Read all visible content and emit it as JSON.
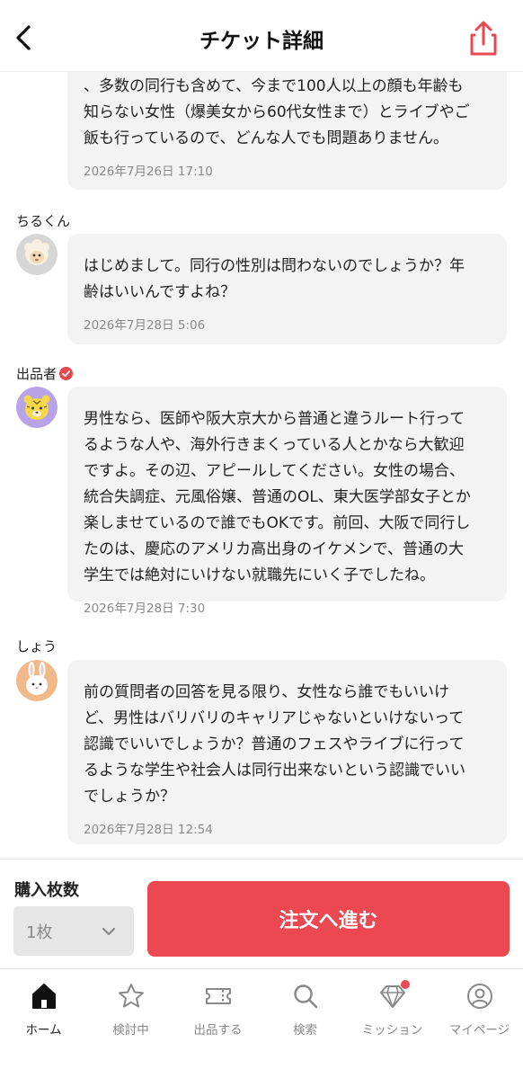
{
  "header": {
    "title": "チケット詳細"
  },
  "messages": [
    {
      "sender": "",
      "text": "、多数の同行も含めて、今まで100人以上の顔も年齢も\n知らない女性（爆美女から60代女性まで）とライブやご\n飯も行っているので、どんな人でも問題ありません。",
      "time": "2026年7月26日 17:10"
    },
    {
      "sender": "ちるくん",
      "avatar_icon": "sheep-avatar-icon",
      "text": "はじめまして。同行の性別は問わないのでしょうか？年\n齢はいいんですよね？",
      "time": "2026年7月28日 5:06"
    },
    {
      "sender": "出品者",
      "verified": true,
      "avatar_icon": "tiger-avatar-icon",
      "text": "男性なら、医師や阪大京大から普通と違うルート行って\nるような人や、海外行きまくっている人とかなら大歓迎\nですよ。その辺、アピールしてください。女性の場合、\n統合失調症、元風俗嬢、普通のOL、東大医学部女子とか\n楽しませているので誰でもOKです。前回、大阪で同行し\nたのは、慶応のアメリカ高出身のイケメンで、普通の大\n学生では絶対にいけない就職先にいく子でしたね。",
      "time": "2026年7月28日 7:30"
    },
    {
      "sender": "しょう",
      "avatar_icon": "rabbit-avatar-icon",
      "text": "前の質問者の回答を見る限り、女性なら誰でもいいけ\nど、男性はバリバリのキャリアじゃないといけないって\n認識でいいでしょうか？普通のフェスやライブに行って\nるような学生や社会人は同行出来ないという認識でいい\nでしょうか？",
      "time": "2026年7月28日 12:54"
    }
  ],
  "purchase": {
    "qty_label": "購入枚数",
    "qty_value": "1枚",
    "order_button": "注文へ進む"
  },
  "nav": {
    "items": [
      {
        "label": "ホーム",
        "icon": "home-icon",
        "active": true
      },
      {
        "label": "検討中",
        "icon": "star-icon"
      },
      {
        "label": "出品する",
        "icon": "ticket-icon"
      },
      {
        "label": "検索",
        "icon": "search-icon"
      },
      {
        "label": "ミッション",
        "icon": "diamond-icon",
        "badge": true
      },
      {
        "label": "マイページ",
        "icon": "user-icon"
      }
    ]
  },
  "colors": {
    "accent": "#eb4851",
    "bubble": "#f3f3f3",
    "verified": "#e8454c"
  }
}
